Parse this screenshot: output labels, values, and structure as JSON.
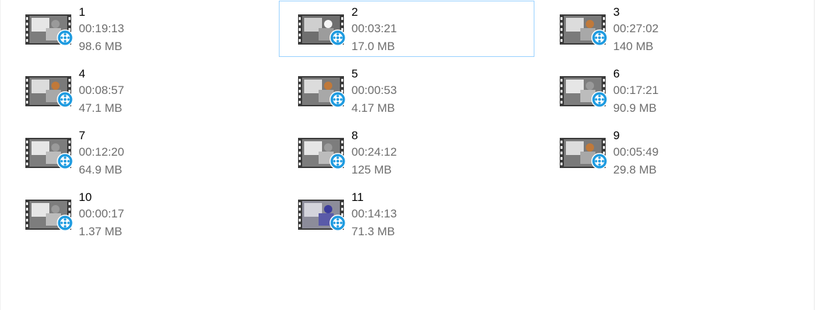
{
  "files": [
    {
      "name": "1",
      "duration": "00:19:13",
      "size": "98.6 MB",
      "icon": "video-file-icon",
      "scene": "white",
      "selected": false
    },
    {
      "name": "2",
      "duration": "00:03:21",
      "size": "17.0 MB",
      "icon": "video-file-icon",
      "scene": "room",
      "selected": true
    },
    {
      "name": "3",
      "duration": "00:27:02",
      "size": "140 MB",
      "icon": "video-file-icon",
      "scene": "dog",
      "selected": false
    },
    {
      "name": "4",
      "duration": "00:08:57",
      "size": "47.1 MB",
      "icon": "video-file-icon",
      "scene": "dog",
      "selected": false
    },
    {
      "name": "5",
      "duration": "00:00:53",
      "size": "4.17 MB",
      "icon": "video-file-icon",
      "scene": "dog",
      "selected": false
    },
    {
      "name": "6",
      "duration": "00:17:21",
      "size": "90.9 MB",
      "icon": "video-file-icon",
      "scene": "white",
      "selected": false
    },
    {
      "name": "7",
      "duration": "00:12:20",
      "size": "64.9 MB",
      "icon": "video-file-icon",
      "scene": "white",
      "selected": false
    },
    {
      "name": "8",
      "duration": "00:24:12",
      "size": "125 MB",
      "icon": "video-file-icon",
      "scene": "white",
      "selected": false
    },
    {
      "name": "9",
      "duration": "00:05:49",
      "size": "29.8 MB",
      "icon": "video-file-icon",
      "scene": "dog",
      "selected": false
    },
    {
      "name": "10",
      "duration": "00:00:17",
      "size": "1.37 MB",
      "icon": "video-file-icon",
      "scene": "white",
      "selected": false
    },
    {
      "name": "11",
      "duration": "00:14:13",
      "size": "71.3 MB",
      "icon": "video-file-icon",
      "scene": "blue",
      "selected": false
    }
  ],
  "colors": {
    "selection_border": "#99d1ff",
    "name_text": "#000000",
    "detail_text": "#6d6d6d",
    "film_strip": "#3a3a3a",
    "reel_badge": "#1e9be0"
  }
}
